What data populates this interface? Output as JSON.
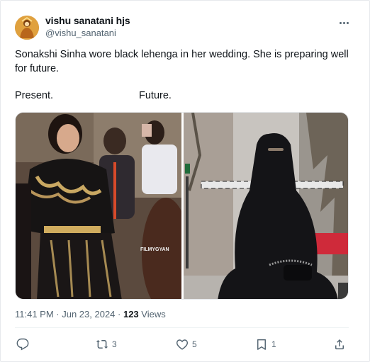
{
  "author": {
    "display_name": "vishu sanatani hjs",
    "handle": "@vishu_sanatani"
  },
  "tweet": {
    "text_line1": "Sonakshi Sinha wore black lehenga in her wedding. She is preparing well",
    "text_line2": "for future.",
    "label_left": "Present.",
    "label_right": "Future."
  },
  "media": {
    "watermark": "FILMYGYAN"
  },
  "meta": {
    "time_date": "11:41 PM · Jun 23, 2024 · ",
    "views_count": "123",
    "views_label": " Views"
  },
  "actions": {
    "reply_count": "",
    "retweet_count": "3",
    "like_count": "5",
    "bookmark_count": "1"
  },
  "icons": {
    "more": "more-icon",
    "reply": "reply-icon",
    "retweet": "retweet-icon",
    "like": "heart-icon",
    "bookmark": "bookmark-icon",
    "share": "share-icon"
  },
  "colors": {
    "text_primary": "#0f1419",
    "text_secondary": "#536471",
    "border": "#e6e9ec"
  }
}
